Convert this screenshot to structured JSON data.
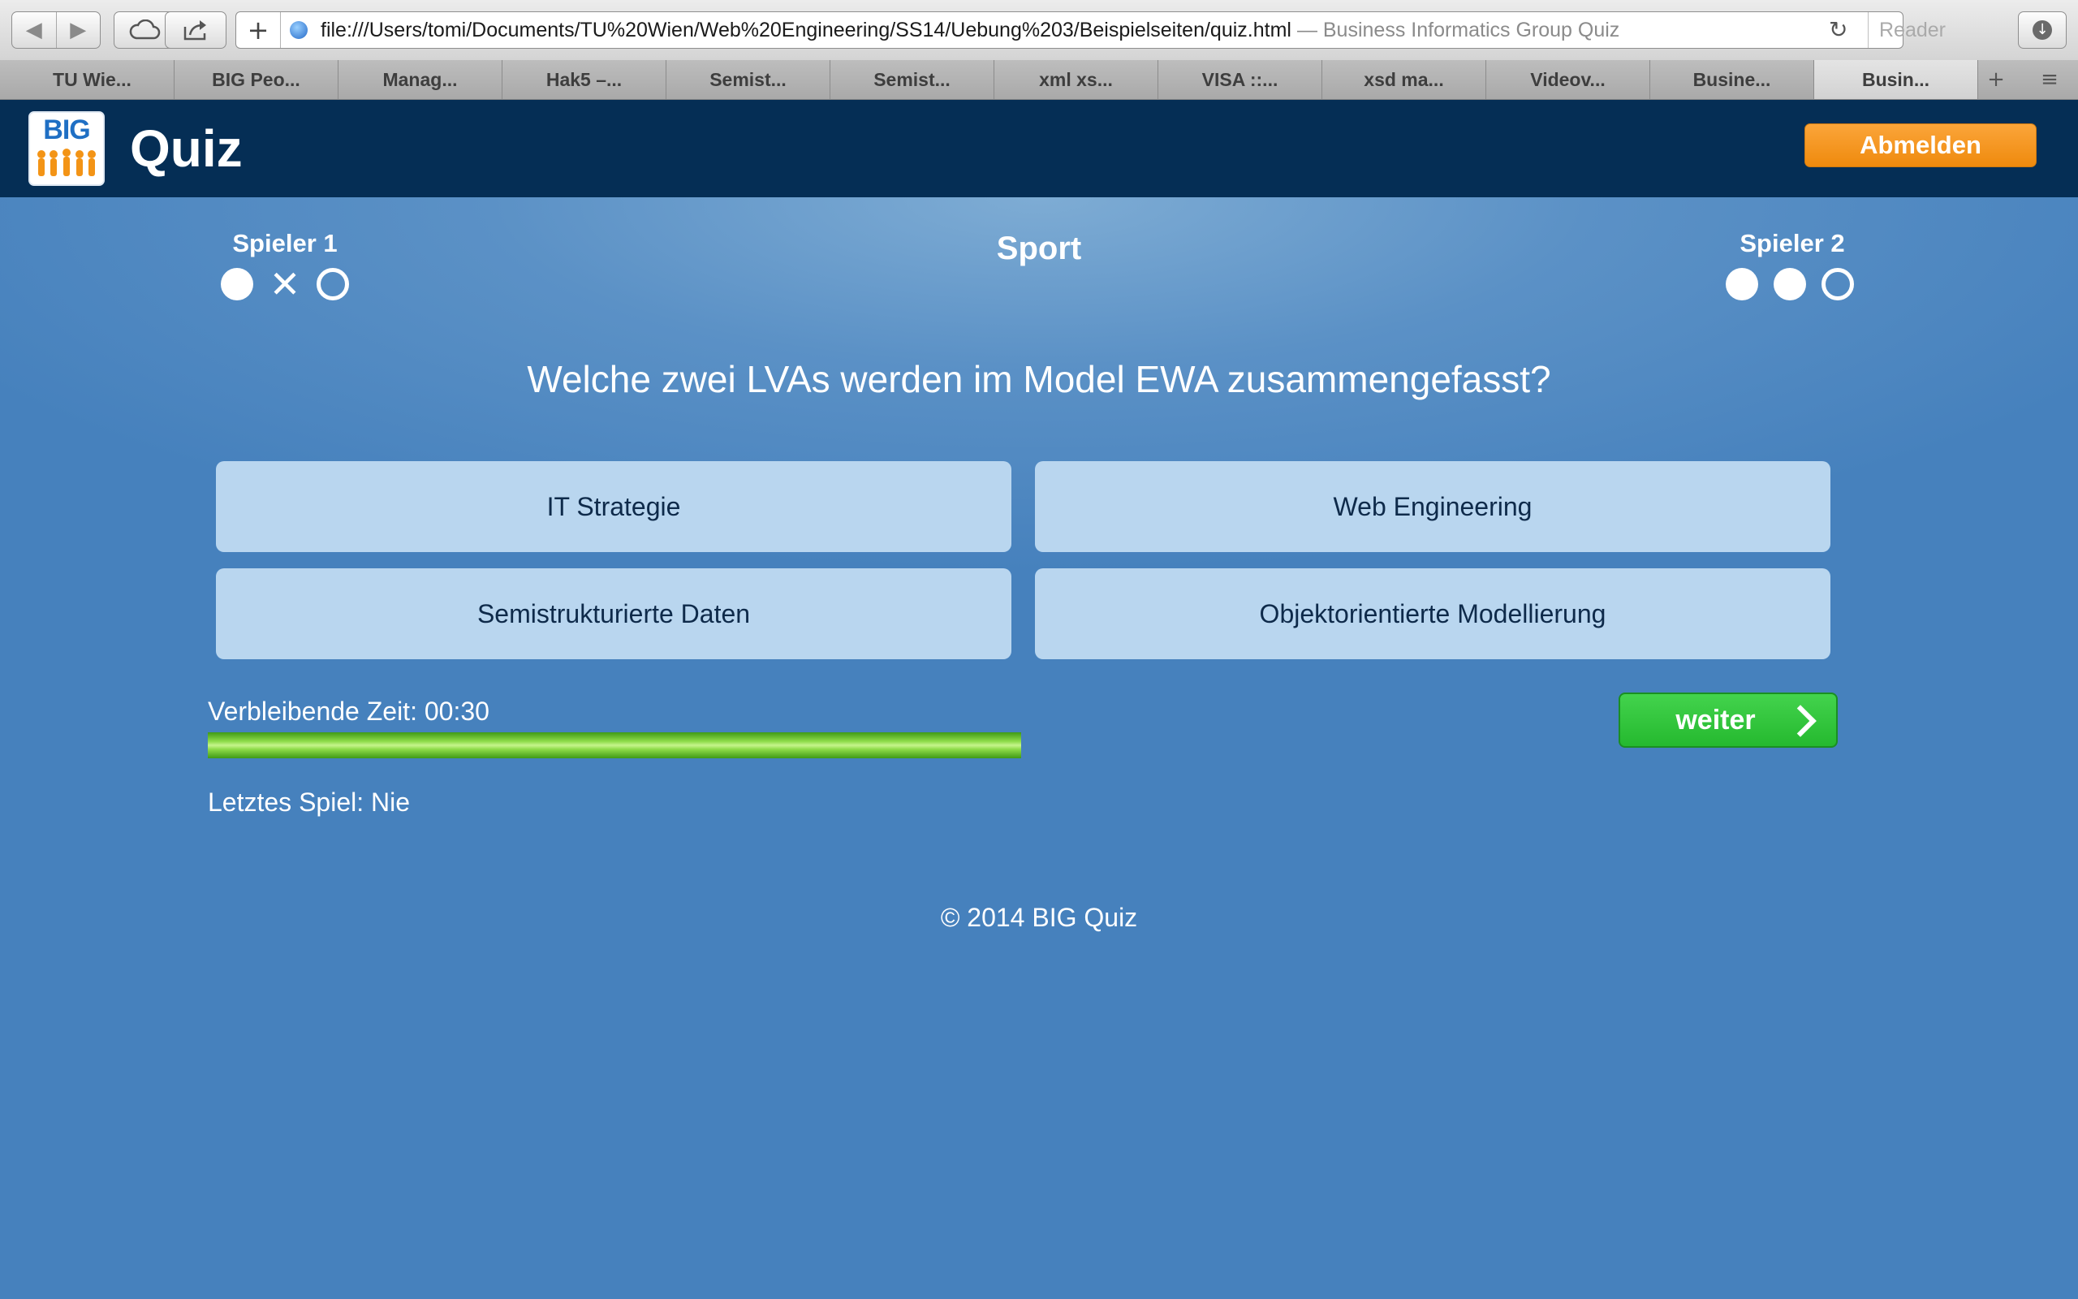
{
  "browser": {
    "url": "file:///Users/tomi/Documents/TU%20Wien/Web%20Engineering/SS14/Uebung%203/Beispielseiten/quiz.html",
    "page_title": "— Business Informatics Group Quiz",
    "reader_label": "Reader",
    "tabs": [
      {
        "label": "TU Wie..."
      },
      {
        "label": "BIG Peo..."
      },
      {
        "label": "Manag..."
      },
      {
        "label": "Hak5 –..."
      },
      {
        "label": "Semist..."
      },
      {
        "label": "Semist..."
      },
      {
        "label": "xml xs..."
      },
      {
        "label": "VISA ::..."
      },
      {
        "label": "xsd ma..."
      },
      {
        "label": "Videov..."
      },
      {
        "label": "Busine..."
      },
      {
        "label": "Busin..."
      }
    ],
    "icons": {
      "back": "back-arrow-icon",
      "forward": "forward-arrow-icon",
      "icloud": "cloud-icon",
      "share": "share-icon",
      "add": "plus-icon",
      "reload": "reload-icon",
      "downloads": "download-icon"
    }
  },
  "header": {
    "logo_text": "BIG",
    "title": "Quiz",
    "logout_label": "Abmelden",
    "colors": {
      "background": "#052e55",
      "logout": "#f39416"
    }
  },
  "game": {
    "player1": {
      "label": "Spieler 1",
      "results": [
        "filled",
        "cross",
        "open"
      ]
    },
    "player2": {
      "label": "Spieler 2",
      "results": [
        "filled",
        "filled",
        "open"
      ]
    },
    "category": "Sport",
    "question": "Welche zwei LVAs werden im Model EWA zusammengefasst?",
    "answers": [
      {
        "label": "IT Strategie"
      },
      {
        "label": "Web Engineering"
      },
      {
        "label": "Semistrukturierte Daten"
      },
      {
        "label": "Objektorientierte Modellierung"
      }
    ],
    "timer_label": "Verbleibende Zeit: 00:30",
    "timer_progress": 1.0,
    "next_label": "weiter",
    "last_game_label": "Letztes Spiel: Nie",
    "colors": {
      "answer": "#b9d6ef",
      "next": "#33c63d",
      "progress": "#8fdc4a",
      "background": "#4681bd"
    }
  },
  "footer": {
    "copyright": "© 2014 BIG Quiz"
  }
}
